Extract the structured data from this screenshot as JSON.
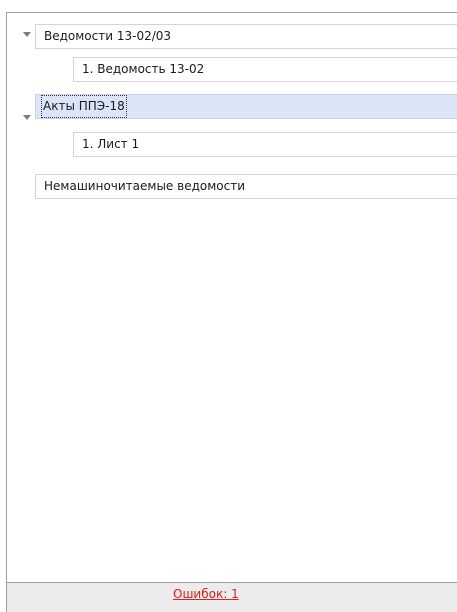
{
  "tree": {
    "groups": [
      {
        "label": "Ведомости 13-02/03",
        "expanded": true,
        "children": [
          {
            "label": "1. Ведомость 13-02"
          }
        ]
      },
      {
        "label": "Акты ППЭ-18",
        "expanded": true,
        "selected": true,
        "children": [
          {
            "label": "1. Лист 1"
          }
        ]
      },
      {
        "label": "Немашиночитаемые ведомости",
        "expanded": false,
        "children": []
      }
    ]
  },
  "footer": {
    "errors_label": "Ошибок: 1"
  },
  "colors": {
    "selection_background": "#dbe5f7",
    "error_link": "#e0201a",
    "footer_background": "#ececec"
  }
}
